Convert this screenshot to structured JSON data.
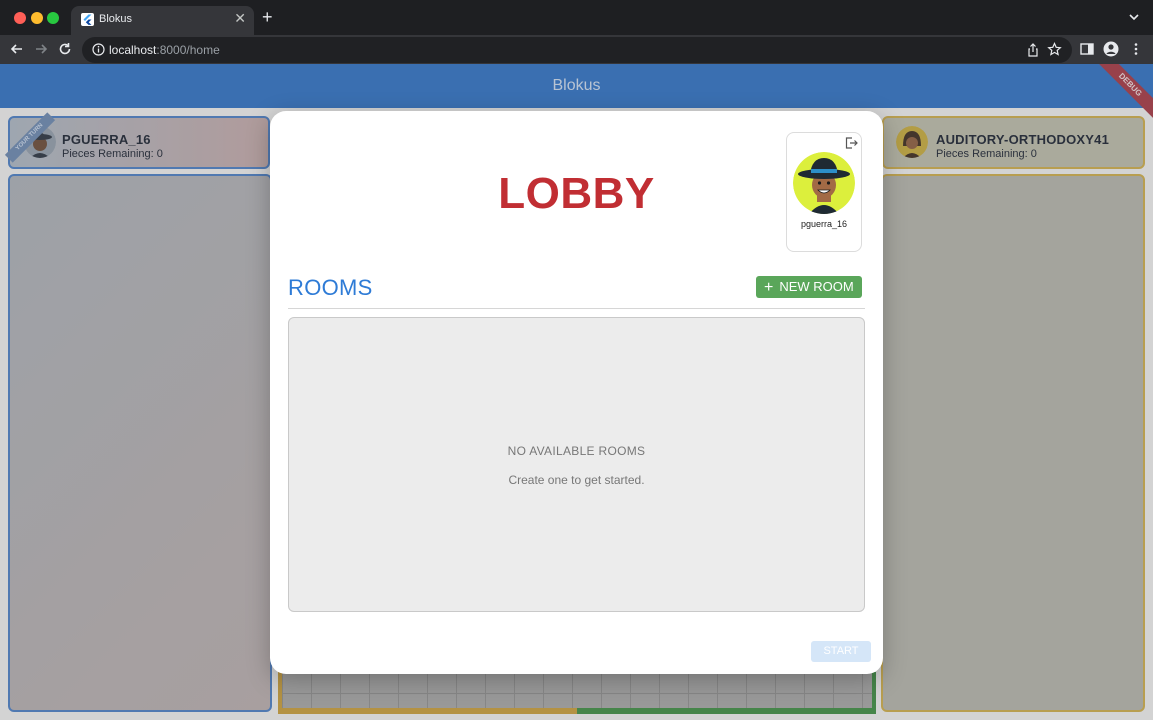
{
  "browser": {
    "tab_title": "Blokus",
    "url_host": "localhost",
    "url_path": ":8000/home"
  },
  "app": {
    "title": "Blokus",
    "debug_label": "DEBUG"
  },
  "players": {
    "left": {
      "name": "PGUERRA_16",
      "pieces": "Pieces Remaining: 0",
      "turn_label": "YOUR TURN"
    },
    "right": {
      "name": "AUDITORY-ORTHODOXY41",
      "pieces": "Pieces Remaining: 0"
    }
  },
  "modal": {
    "title": "LOBBY",
    "profile_name": "pguerra_16",
    "rooms_title": "ROOMS",
    "new_room_label": "NEW ROOM",
    "empty_title": "NO AVAILABLE ROOMS",
    "empty_subtitle": "Create one to get started.",
    "start_label": "START"
  },
  "colors": {
    "accent_blue": "#2e7bd6",
    "lobby_red": "#c12e33",
    "new_room_green": "#5aa65a",
    "appbar_blue": "#2f6fc0"
  }
}
